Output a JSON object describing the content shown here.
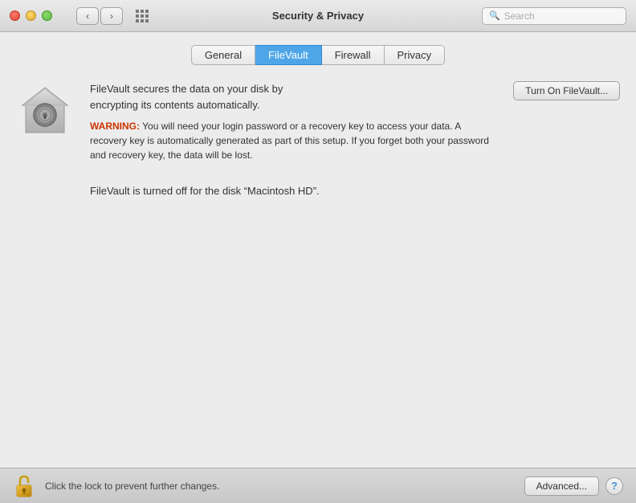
{
  "titlebar": {
    "title": "Security & Privacy",
    "search_placeholder": "Search",
    "back_label": "‹",
    "forward_label": "›"
  },
  "tabs": [
    {
      "id": "general",
      "label": "General",
      "active": false
    },
    {
      "id": "filevault",
      "label": "FileVault",
      "active": true
    },
    {
      "id": "firewall",
      "label": "Firewall",
      "active": false
    },
    {
      "id": "privacy",
      "label": "Privacy",
      "active": false
    }
  ],
  "filevault": {
    "description_line1": "FileVault secures the data on your disk by",
    "description_line2": "encrypting its contents automatically.",
    "warning_label": "WARNING:",
    "warning_text": " You will need your login password or a recovery key to access your data. A recovery key is automatically generated as part of this setup. If you forget both your password and recovery key, the data will be lost.",
    "turn_on_label": "Turn On FileVault...",
    "status_text": "FileVault is turned off for the disk “Macintosh HD”."
  },
  "bottom_bar": {
    "lock_text": "Click the lock to prevent further changes.",
    "advanced_label": "Advanced...",
    "help_label": "?"
  }
}
